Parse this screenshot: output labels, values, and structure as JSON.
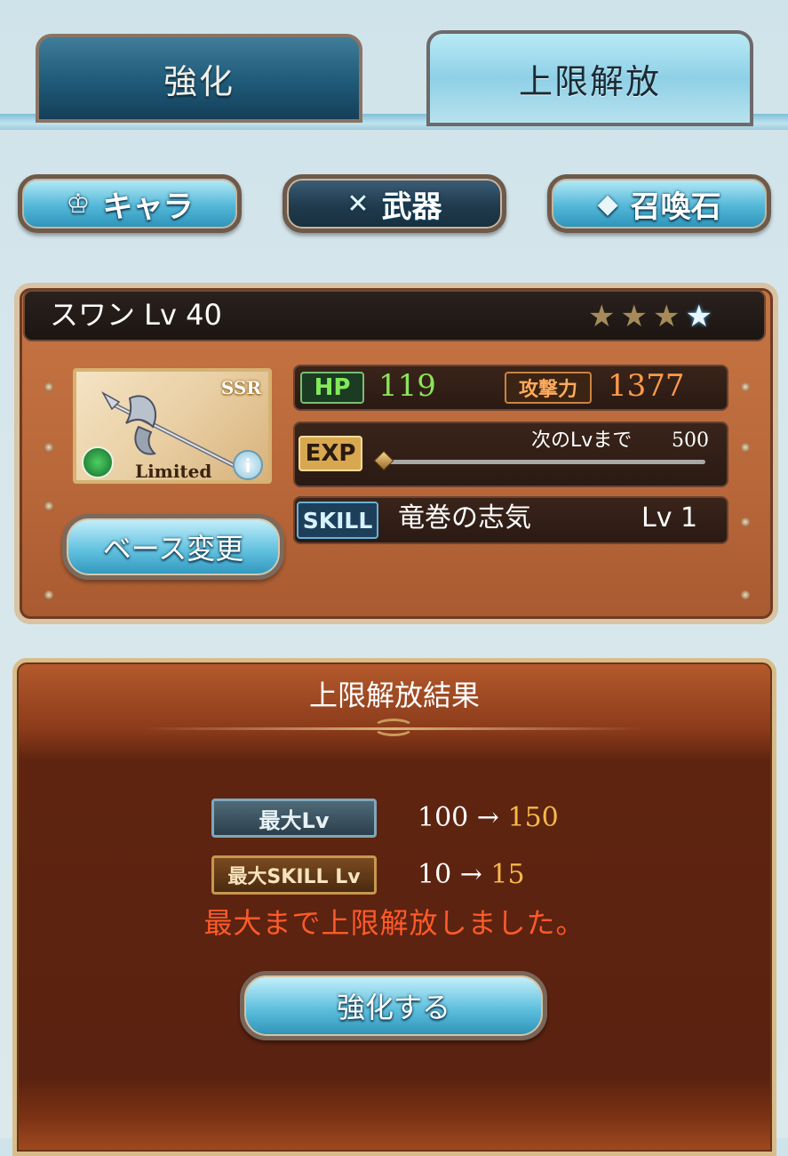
{
  "tabs": [
    {
      "label": "強化",
      "active": false
    },
    {
      "label": "上限解放",
      "active": true
    }
  ],
  "categories": [
    {
      "label": "キャラ",
      "icon": "character-icon",
      "active": false
    },
    {
      "label": "武器",
      "icon": "crossed-swords-icon",
      "active": true
    },
    {
      "label": "召喚石",
      "icon": "crystal-icon",
      "active": false
    }
  ],
  "weapon": {
    "name_level": "スワン Lv 40",
    "stars_total": 4,
    "stars_filled": 3,
    "rarity": "SSR",
    "limited_label": "Limited",
    "hp_label": "HP",
    "hp": "119",
    "atk_label": "攻撃力",
    "atk": "1377",
    "exp_label": "EXP",
    "next_lv_label": "次のLvまで",
    "next_lv_value": "500",
    "exp_progress": 0.0,
    "skill_label": "SKILL",
    "skill_name": "竜巻の志気",
    "skill_level": "Lv 1",
    "base_change_label": "ベース変更"
  },
  "result": {
    "title": "上限解放結果",
    "max_lv_label": "最大Lv",
    "max_lv_from": "100 →",
    "max_lv_to": "150",
    "max_skill_label": "最大SKILL Lv",
    "max_skill_from": "10 →",
    "max_skill_to": "15",
    "message": "最大まで上限解放しました。",
    "enhance_button": "強化する"
  },
  "colors": {
    "accent_blue": "#5fc0de",
    "panel_brown": "#b8673a",
    "hp_green": "#8ce45a",
    "atk_orange": "#ff9a4a",
    "message_red": "#ff5a2a",
    "new_value_gold": "#f7b84a"
  }
}
